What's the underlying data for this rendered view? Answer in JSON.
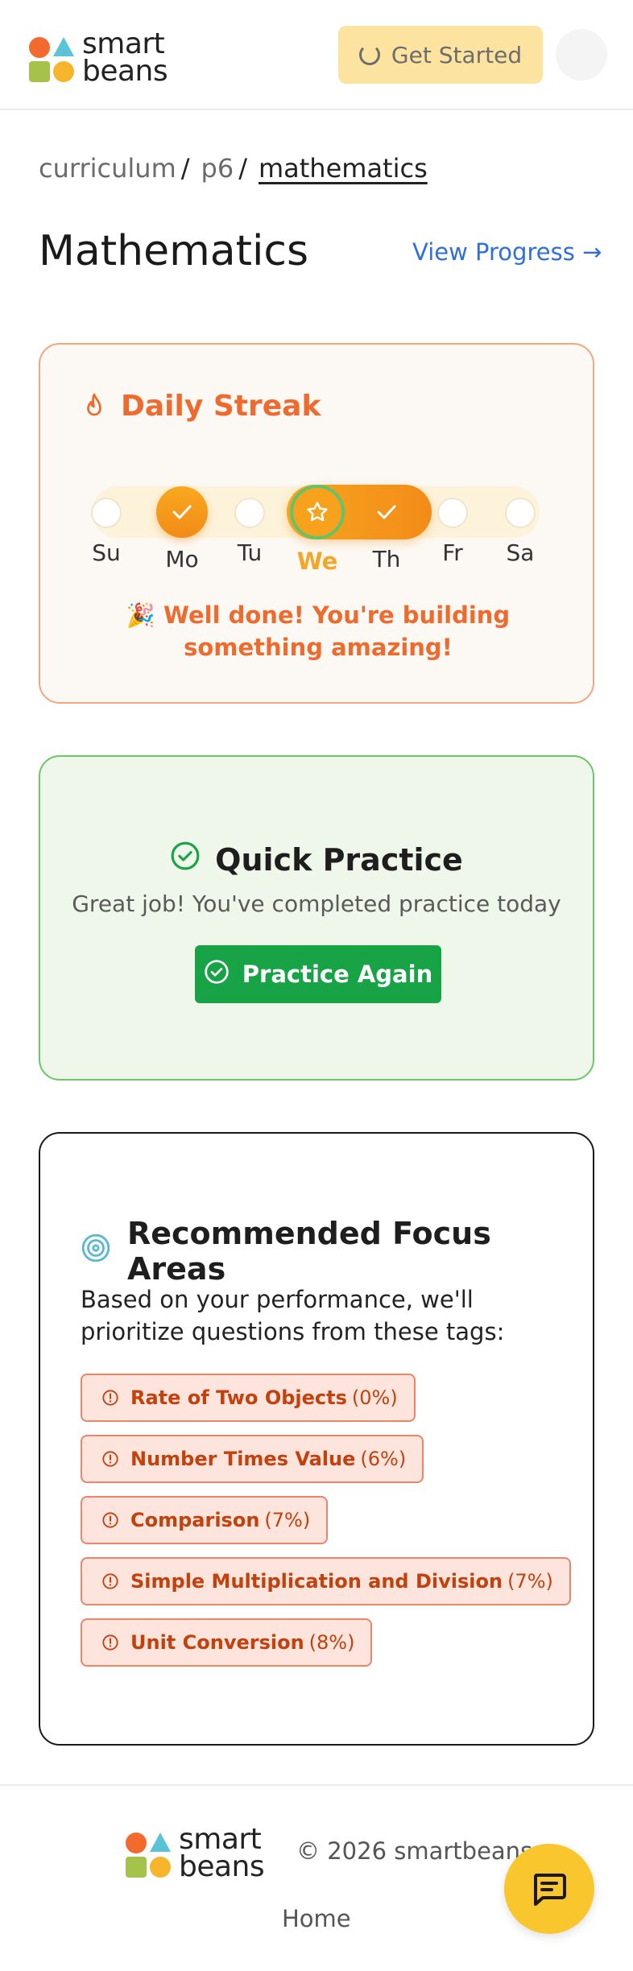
{
  "brand": {
    "line1": "smart",
    "line2": "beans"
  },
  "header": {
    "get_started_label": "Get Started"
  },
  "breadcrumb": {
    "items": [
      "curriculum",
      "p6",
      "mathematics"
    ],
    "separator": "/"
  },
  "page": {
    "title": "Mathematics",
    "view_progress_label": "View Progress →"
  },
  "streak": {
    "title": "Daily Streak",
    "days": [
      {
        "label": "Su",
        "state": "empty"
      },
      {
        "label": "Mo",
        "state": "done"
      },
      {
        "label": "Tu",
        "state": "empty"
      },
      {
        "label": "We",
        "state": "today"
      },
      {
        "label": "Th",
        "state": "done"
      },
      {
        "label": "Fr",
        "state": "empty"
      },
      {
        "label": "Sa",
        "state": "empty"
      }
    ],
    "message": "🎉 Well done! You're building something amazing!"
  },
  "practice": {
    "title": "Quick Practice",
    "subtitle": "Great job! You've completed practice today",
    "button_label": "Practice Again"
  },
  "focus": {
    "title": "Recommended Focus Areas",
    "description": "Based on your performance, we'll prioritize questions from these tags:",
    "tags": [
      {
        "name": "Rate of Two Objects",
        "percent": "(0%)"
      },
      {
        "name": "Number Times Value",
        "percent": "(6%)"
      },
      {
        "name": "Comparison",
        "percent": "(7%)"
      },
      {
        "name": "Simple Multiplication and Division",
        "percent": "(7%)"
      },
      {
        "name": "Unit Conversion",
        "percent": "(8%)"
      }
    ]
  },
  "footer": {
    "copyright": "© 2026 smartbeans",
    "home_label": "Home"
  },
  "colors": {
    "accent_orange": "#ee6a2e",
    "streak_gold": "#f7a11d",
    "practice_green": "#18a346",
    "link_blue": "#2f6fdb",
    "tag_text": "#c2410c",
    "chat_yellow": "#fac62e"
  },
  "icons": {
    "streak": "flame-icon",
    "practice": "check-circle-icon",
    "focus": "target-icon",
    "tag": "alert-circle-icon",
    "chat": "chat-icon",
    "loading": "spinner-icon"
  }
}
